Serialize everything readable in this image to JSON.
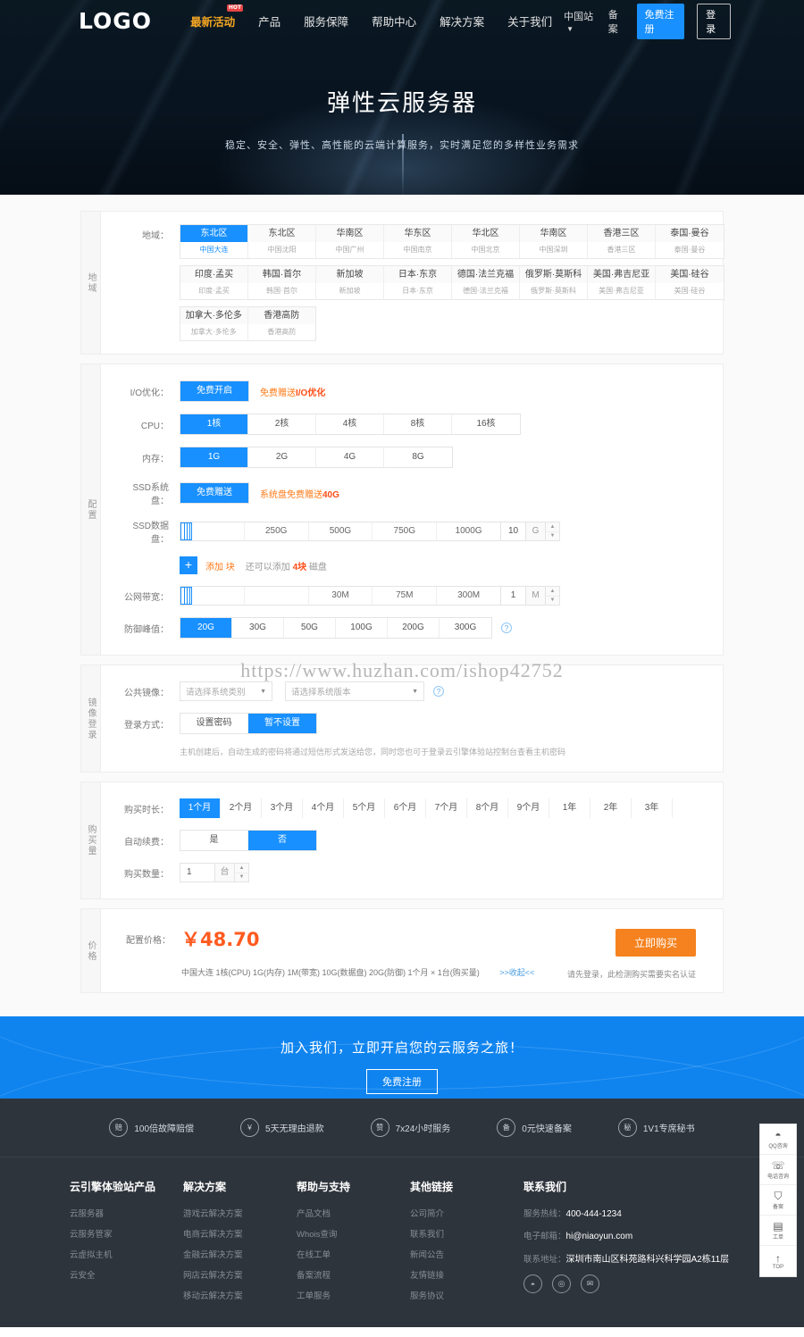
{
  "header": {
    "logo": "LOGO",
    "nav": [
      {
        "label": "最新活动",
        "badge": "HOT",
        "hot": true
      },
      {
        "label": "产品",
        "hot": false
      },
      {
        "label": "服务保障",
        "hot": false
      },
      {
        "label": "帮助中心",
        "hot": false
      },
      {
        "label": "解决方案",
        "hot": false
      },
      {
        "label": "关于我们",
        "hot": false
      }
    ],
    "site_select": "中国站",
    "beian": "备案",
    "register": "免费注册",
    "login": "登录"
  },
  "hero": {
    "title": "弹性云服务器",
    "subtitle": "稳定、安全、弹性、高性能的云端计算服务，实时满足您的多样性业务需求"
  },
  "watermark": "https://www.huzhan.com/ishop42752",
  "region_panel": {
    "tab": "地域",
    "label": "地域：",
    "rows": [
      [
        {
          "name": "东北区",
          "city": "中国大连",
          "selected": true
        },
        {
          "name": "东北区",
          "city": "中国沈阳",
          "selected": false
        },
        {
          "name": "华南区",
          "city": "中国广州",
          "selected": false
        },
        {
          "name": "华东区",
          "city": "中国南京",
          "selected": false
        },
        {
          "name": "华北区",
          "city": "中国北京",
          "selected": false
        },
        {
          "name": "华南区",
          "city": "中国深圳",
          "selected": false
        },
        {
          "name": "香港三区",
          "city": "香港三区",
          "selected": false
        },
        {
          "name": "泰国·曼谷",
          "city": "泰国·曼谷",
          "selected": false
        }
      ],
      [
        {
          "name": "印度·孟买",
          "city": "印度·孟买",
          "selected": false
        },
        {
          "name": "韩国·首尔",
          "city": "韩国·首尔",
          "selected": false
        },
        {
          "name": "新加坡",
          "city": "新加坡",
          "selected": false
        },
        {
          "name": "日本·东京",
          "city": "日本·东京",
          "selected": false
        },
        {
          "name": "德国·法兰克福",
          "city": "德国·法兰克福",
          "selected": false
        },
        {
          "name": "俄罗斯·莫斯科",
          "city": "俄罗斯·莫斯科",
          "selected": false
        },
        {
          "name": "美国·弗吉尼亚",
          "city": "美国·弗吉尼亚",
          "selected": false
        },
        {
          "name": "美国·硅谷",
          "city": "美国·硅谷",
          "selected": false
        }
      ],
      [
        {
          "name": "加拿大·多伦多",
          "city": "加拿大·多伦多",
          "selected": false
        },
        {
          "name": "香港高防",
          "city": "香港高防",
          "selected": false
        }
      ]
    ]
  },
  "config_panel": {
    "tab": "配置",
    "io": {
      "label": "I/O优化：",
      "options": [
        {
          "label": "免费开启",
          "selected": true
        }
      ],
      "note_pre": "免费赠送",
      "note_bold": "I/O优化"
    },
    "cpu": {
      "label": "CPU：",
      "options": [
        {
          "label": "1核",
          "selected": true
        },
        {
          "label": "2核",
          "selected": false
        },
        {
          "label": "4核",
          "selected": false
        },
        {
          "label": "8核",
          "selected": false
        },
        {
          "label": "16核",
          "selected": false
        }
      ]
    },
    "memory": {
      "label": "内存：",
      "options": [
        {
          "label": "1G",
          "selected": true
        },
        {
          "label": "2G",
          "selected": false
        },
        {
          "label": "4G",
          "selected": false
        },
        {
          "label": "8G",
          "selected": false
        }
      ]
    },
    "ssd_system": {
      "label": "SSD系统盘：",
      "options": [
        {
          "label": "免费赠送",
          "selected": true
        }
      ],
      "note_pre": "系统盘免费赠送",
      "note_bold": "40G"
    },
    "ssd_data": {
      "label": "SSD数据盘：",
      "ticks": [
        "",
        "250G",
        "500G",
        "750G",
        "1000G"
      ],
      "value": "10",
      "unit": "G"
    },
    "add_disk": {
      "plus": "+",
      "label": "添加  块",
      "note_pre": "还可以添加 ",
      "note_bold": "4块",
      "note_post": " 磁盘"
    },
    "bandwidth": {
      "label": "公网带宽：",
      "ticks": [
        "",
        "",
        "30M",
        "75M",
        "300M"
      ],
      "value": "1",
      "unit": "M"
    },
    "defense": {
      "label": "防御峰值：",
      "options": [
        {
          "label": "20G",
          "selected": true
        },
        {
          "label": "30G",
          "selected": false
        },
        {
          "label": "50G",
          "selected": false
        },
        {
          "label": "100G",
          "selected": false
        },
        {
          "label": "200G",
          "selected": false
        },
        {
          "label": "300G",
          "selected": false
        }
      ],
      "help": "?"
    }
  },
  "image_panel": {
    "tab": "镜像登录",
    "image": {
      "label": "公共镜像：",
      "select1": "请选择系统类别",
      "select2": "请选择系统版本",
      "help": "?"
    },
    "login_mode": {
      "label": "登录方式：",
      "options": [
        {
          "label": "设置密码",
          "selected": false
        },
        {
          "label": "暂不设置",
          "selected": true
        }
      ]
    },
    "hint": "主机创建后，自动生成的密码将通过短信形式发送给您，同时您也可于登录云引擎体验站控制台查看主机密码"
  },
  "duration_panel": {
    "tab": "购买量",
    "duration": {
      "label": "购买时长：",
      "options": [
        {
          "label": "1个月",
          "selected": true
        },
        {
          "label": "2个月",
          "selected": false
        },
        {
          "label": "3个月",
          "selected": false
        },
        {
          "label": "4个月",
          "selected": false
        },
        {
          "label": "5个月",
          "selected": false
        },
        {
          "label": "6个月",
          "selected": false
        },
        {
          "label": "7个月",
          "selected": false
        },
        {
          "label": "8个月",
          "selected": false
        },
        {
          "label": "9个月",
          "selected": false
        },
        {
          "label": "1年",
          "selected": false
        },
        {
          "label": "2年",
          "selected": false
        },
        {
          "label": "3年",
          "selected": false
        }
      ]
    },
    "autorenew": {
      "label": "自动续费：",
      "options": [
        {
          "label": "是",
          "selected": false
        },
        {
          "label": "否",
          "selected": true
        }
      ]
    },
    "quantity": {
      "label": "购买数量：",
      "value": "1",
      "unit": "台"
    }
  },
  "price_panel": {
    "tab": "价格",
    "label": "配置价格：",
    "currency": "￥",
    "amount": "48.70",
    "summary": "中国大连  1核(CPU)  1G(内存)  1M(带宽)  10G(数据盘)  20G(防御)  1个月 × 1台(购买量)",
    "collapse": ">>收起<<",
    "buy_button": "立即购买",
    "buy_note": "请先登录，此检测购买需要实名认证"
  },
  "cta": {
    "title": "加入我们，立即开启您的云服务之旅！",
    "button": "免费注册"
  },
  "features": [
    {
      "icon": "赔",
      "label": "100倍故障赔偿"
    },
    {
      "icon": "￥",
      "label": "5天无理由退款"
    },
    {
      "icon": "赞",
      "label": "7x24小时服务"
    },
    {
      "icon": "备",
      "label": "0元快速备案"
    },
    {
      "icon": "秘",
      "label": "1V1专席秘书"
    }
  ],
  "footer": {
    "columns": [
      {
        "title": "云引擎体验站产品",
        "links": [
          "云服务器",
          "云服务管家",
          "云虚拟主机",
          "云安全"
        ]
      },
      {
        "title": "解决方案",
        "links": [
          "游戏云解决方案",
          "电商云解决方案",
          "金融云解决方案",
          "网店云解决方案",
          "移动云解决方案"
        ]
      },
      {
        "title": "帮助与支持",
        "links": [
          "产品文档",
          "Whois查询",
          "在线工单",
          "备案流程",
          "工单服务"
        ]
      },
      {
        "title": "其他链接",
        "links": [
          "公司简介",
          "联系我们",
          "新闻公告",
          "友情链接",
          "服务协议"
        ]
      }
    ],
    "contact": {
      "title": "联系我们",
      "phone_label": "服务热线：",
      "phone": "400-444-1234",
      "email_label": "电子邮箱：",
      "email": "hi@niaoyun.com",
      "addr_label": "联系地址：",
      "addr": "深圳市南山区科苑路科兴科学园A2栋11层",
      "socials": [
        "qq-icon",
        "weibo-icon",
        "mail-icon"
      ]
    }
  },
  "side_toolbar": [
    {
      "icon": "qq-icon",
      "glyph": "◓",
      "label": "QQ咨询"
    },
    {
      "icon": "phone-icon",
      "glyph": "☏",
      "label": "电话咨询"
    },
    {
      "icon": "shield-icon",
      "glyph": "⛉",
      "label": "备案"
    },
    {
      "icon": "ticket-icon",
      "glyph": "▤",
      "label": "工单"
    },
    {
      "icon": "top-arrow-icon",
      "glyph": "↑",
      "label": "TOP"
    }
  ]
}
